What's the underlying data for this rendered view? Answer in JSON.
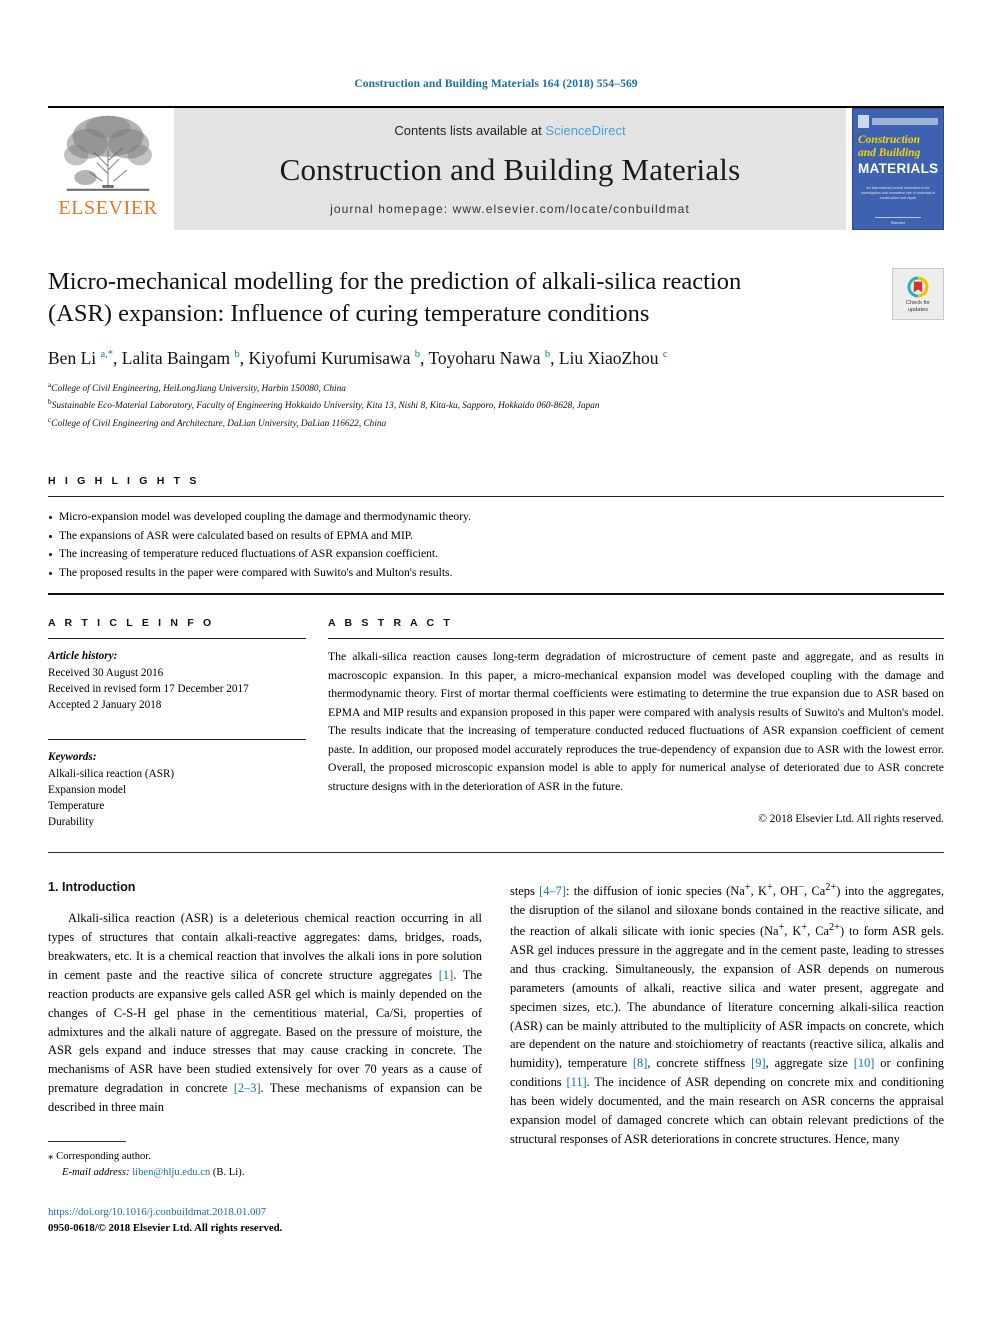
{
  "running_head": "Construction and Building Materials 164 (2018) 554–569",
  "masthead": {
    "publisher_name": "ELSEVIER",
    "contents_prefix": "Contents lists available at ",
    "contents_link": "ScienceDirect",
    "journal_name": "Construction and Building Materials",
    "homepage": "journal homepage: www.elsevier.com/locate/conbuildmat",
    "cover": {
      "line1": "Construction",
      "line2": "and Building",
      "line3": "MATERIALS",
      "subtitle": "An international journal dedicated to the investigation and innovative use of materials in construction and repair",
      "footer": "Elsevier"
    }
  },
  "title": "Micro-mechanical modelling for the prediction of alkali-silica reaction (ASR) expansion: Influence of curing temperature conditions",
  "crossmark": {
    "line1": "Check for",
    "line2": "updates"
  },
  "authors_html": "Ben Li <sup>a,*</sup>, Lalita Baingam <sup>b</sup>, Kiyofumi Kurumisawa <sup>b</sup>, Toyoharu Nawa <sup>b</sup>, Liu XiaoZhou <sup>c</sup>",
  "affiliations": [
    {
      "mark": "a",
      "text": "College of Civil Engineering, HeiLongJiang University, Harbin 150080, China"
    },
    {
      "mark": "b",
      "text": "Sustainable Eco-Material Laboratory, Faculty of Engineering Hokkaido University, Kita 13, Nishi 8, Kita-ku, Sapporo, Hokkaido 060-8628, Japan"
    },
    {
      "mark": "c",
      "text": "College of Civil Engineering and Architecture, DaLian University, DaLian 116622, China"
    }
  ],
  "highlights": {
    "heading": "H I G H L I G H T S",
    "items": [
      "Micro-expansion model was developed coupling the damage and thermodynamic theory.",
      "The expansions of ASR were calculated based on results of EPMA and MIP.",
      "The increasing of temperature reduced fluctuations of ASR expansion coefficient.",
      "The proposed results in the paper were compared with Suwito's and Multon's results."
    ]
  },
  "article_info": {
    "heading": "A R T I C L E  I N F O",
    "history_label": "Article history:",
    "history": [
      "Received 30 August 2016",
      "Received in revised form 17 December 2017",
      "Accepted 2 January 2018"
    ],
    "keywords_label": "Keywords:",
    "keywords": [
      "Alkali-silica reaction (ASR)",
      "Expansion model",
      "Temperature",
      "Durability"
    ]
  },
  "abstract": {
    "heading": "A B S T R A C T",
    "text": "The alkali-silica reaction causes long-term degradation of microstructure of cement paste and aggregate, and as results in macroscopic expansion. In this paper, a micro-mechanical expansion model was developed coupling with the damage and thermodynamic theory. First of mortar thermal coefficients were estimating to determine the true expansion due to ASR based on EPMA and MIP results and expansion proposed in this paper were compared with analysis results of Suwito's and Multon's model. The results indicate that the increasing of temperature conducted reduced fluctuations of ASR expansion coefficient of cement paste. In addition, our proposed model accurately reproduces the true-dependency of expansion due to ASR with the lowest error. Overall, the proposed microscopic expansion model is able to apply for numerical analyse of deteriorated due to ASR concrete structure designs with in the deterioration of ASR in the future.",
    "copyright": "© 2018 Elsevier Ltd. All rights reserved."
  },
  "body": {
    "section_title": "1. Introduction",
    "left_paragraph_html": "Alkali-silica reaction (ASR) is a deleterious chemical reaction occurring in all types of structures that contain alkali-reactive aggregates: dams, bridges, roads, breakwaters, etc. It is a chemical reaction that involves the alkali ions in pore solution in cement paste and the reactive silica of concrete structure aggregates <span class=\"ref\">[1]</span>. The reaction products are expansive gels called ASR gel which is mainly depended on the changes of C-S-H gel phase in the cementitious material, Ca/Si, properties of admixtures and the alkali nature of aggregate. Based on the pressure of moisture, the ASR gels expand and induce stresses that may cause cracking in concrete. The mechanisms of ASR have been studied extensively for over 70 years as a cause of premature degradation in concrete <span class=\"ref\">[2–3]</span>. These mechanisms of expansion can be described in three main",
    "right_paragraph_html": "steps <span class=\"ref\">[4–7]</span>: the diffusion of ionic species (Na<sup>+</sup>, K<sup>+</sup>, OH<sup>−</sup>, Ca<sup>2+</sup>) into the aggregates, the disruption of the silanol and siloxane bonds contained in the reactive silicate, and the reaction of alkali silicate with ionic species (Na<sup>+</sup>, K<sup>+</sup>, Ca<sup>2+</sup>) to form ASR gels. ASR gel induces pressure in the aggregate and in the cement paste, leading to stresses and thus cracking. Simultaneously, the expansion of ASR depends on numerous parameters (amounts of alkali, reactive silica and water present, aggregate and specimen sizes, etc.). The abundance of literature concerning alkali-silica reaction (ASR) can be mainly attributed to the multiplicity of ASR impacts on concrete, which are dependent on the nature and stoichiometry of reactants (reactive silica, alkalis and humidity), temperature <span class=\"ref\">[8]</span>, concrete stiffness <span class=\"ref\">[9]</span>, aggregate size <span class=\"ref\">[10]</span> or confining conditions <span class=\"ref\">[11]</span>. The incidence of ASR depending on concrete mix and conditioning has been widely documented, and the main research on ASR concerns the appraisal expansion model of damaged concrete which can obtain relevant predictions of the structural responses of ASR deteriorations in concrete structures. Hence, many"
  },
  "footnotes": {
    "corresponding_author": "Corresponding author.",
    "email_label": "E-mail address:",
    "email": "liben@hlju.edu.cn",
    "email_owner": "(B. Li).",
    "doi": "https://doi.org/10.1016/j.conbuildmat.2018.01.007",
    "issn_line": "0950-0618/© 2018 Elsevier Ltd. All rights reserved."
  },
  "colors": {
    "link": "#1a6fa8",
    "elsevier_orange": "#e87722",
    "cover_blue": "#3f62b0",
    "cover_yellow": "#f5d20c",
    "band_gray": "#e3e3e3"
  }
}
